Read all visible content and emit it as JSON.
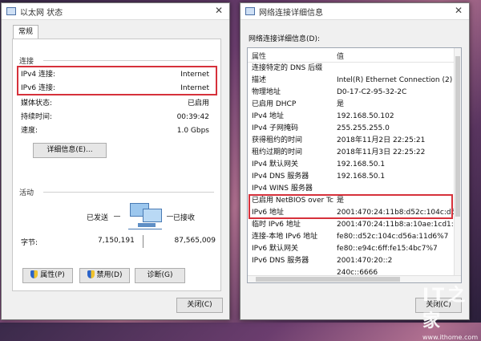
{
  "left": {
    "title": "以太网 状态",
    "tab": "常规",
    "connection": {
      "section": "连接",
      "rows": [
        {
          "label": "IPv4 连接:",
          "value": "Internet"
        },
        {
          "label": "IPv6 连接:",
          "value": "Internet"
        },
        {
          "label": "媒体状态:",
          "value": "已启用"
        },
        {
          "label": "持续时间:",
          "value": "00:39:42"
        },
        {
          "label": "速度:",
          "value": "1.0 Gbps"
        }
      ],
      "details_button": "详细信息(E)..."
    },
    "activity": {
      "section": "活动",
      "sent_label": "已发送",
      "received_label": "已接收",
      "bytes_label": "字节:",
      "bytes_sent": "7,150,191",
      "bytes_received": "87,565,009"
    },
    "buttons": {
      "properties": "属性(P)",
      "disable": "禁用(D)",
      "diagnose": "诊断(G)",
      "close": "关闭(C)"
    }
  },
  "right": {
    "title": "网络连接详细信息",
    "heading": "网络连接详细信息(D):",
    "col_property": "属性",
    "col_value": "值",
    "rows": [
      {
        "p": "连接特定的 DNS 后缀",
        "v": ""
      },
      {
        "p": "描述",
        "v": "Intel(R) Ethernet Connection (2) I218-"
      },
      {
        "p": "物理地址",
        "v": "D0-17-C2-95-32-2C"
      },
      {
        "p": "已启用 DHCP",
        "v": "是"
      },
      {
        "p": "IPv4 地址",
        "v": "192.168.50.102"
      },
      {
        "p": "IPv4 子网掩码",
        "v": "255.255.255.0"
      },
      {
        "p": "获得租约的时间",
        "v": "2018年11月2日 22:25:21"
      },
      {
        "p": "租约过期的时间",
        "v": "2018年11月3日 22:25:22"
      },
      {
        "p": "IPv4 默认网关",
        "v": "192.168.50.1"
      },
      {
        "p": "IPv4 DNS 服务器",
        "v": "192.168.50.1"
      },
      {
        "p": "IPv4 WINS 服务器",
        "v": ""
      },
      {
        "p": "已启用 NetBIOS over Tc...",
        "v": "是"
      },
      {
        "p": "IPv6 地址",
        "v": "2001:470:24:11b8:d52c:104c:d56a:11"
      },
      {
        "p": "临时 IPv6 地址",
        "v": "2001:470:24:11b8:a:10ae:1cd1:7210"
      },
      {
        "p": "连接-本地 IPv6 地址",
        "v": "fe80::d52c:104c:d56a:11d6%7"
      },
      {
        "p": "IPv6 默认网关",
        "v": "fe80::e94c:6ff:fe15:4bc7%7"
      },
      {
        "p": "IPv6 DNS 服务器",
        "v": "2001:470:20::2"
      },
      {
        "p": "",
        "v": "240c::6666"
      }
    ]
  },
  "watermark": {
    "logo": "IT之家",
    "url": "www.ithome.com"
  },
  "colors": {
    "highlight": "#d6313b",
    "dialog_bg": "#f0f0f0"
  }
}
